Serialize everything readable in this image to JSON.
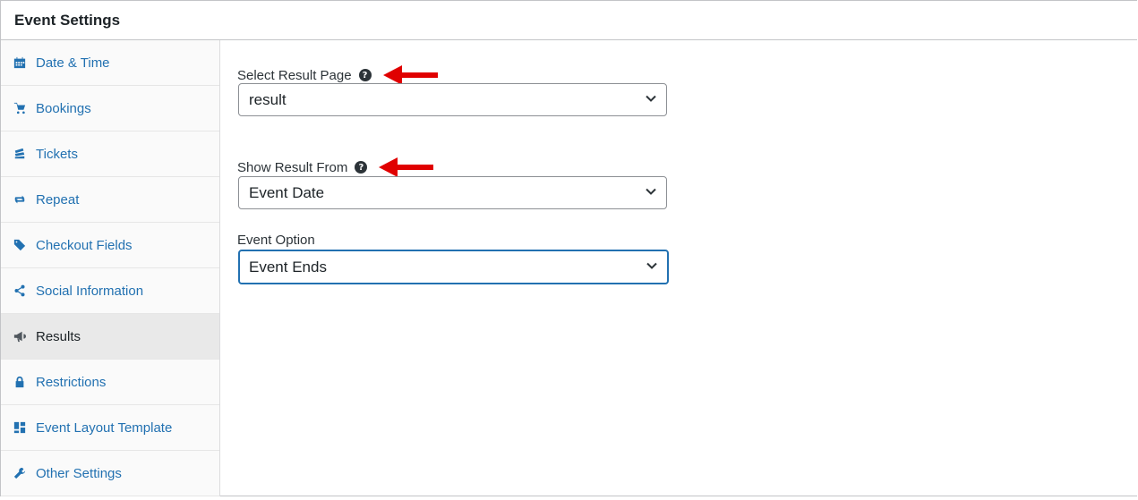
{
  "panel": {
    "title": "Event Settings"
  },
  "sidebar": {
    "items": [
      {
        "label": "Date & Time",
        "icon": "calendar-icon"
      },
      {
        "label": "Bookings",
        "icon": "cart-icon"
      },
      {
        "label": "Tickets",
        "icon": "tickets-icon"
      },
      {
        "label": "Repeat",
        "icon": "repeat-icon"
      },
      {
        "label": "Checkout Fields",
        "icon": "tag-icon"
      },
      {
        "label": "Social Information",
        "icon": "share-icon"
      },
      {
        "label": "Results",
        "icon": "megaphone-icon",
        "active": true
      },
      {
        "label": "Restrictions",
        "icon": "lock-icon"
      },
      {
        "label": "Event Layout Template",
        "icon": "layout-icon"
      },
      {
        "label": "Other Settings",
        "icon": "wrench-icon"
      }
    ]
  },
  "form": {
    "result_page": {
      "label": "Select Result Page",
      "value": "result"
    },
    "show_result_from": {
      "label": "Show Result From",
      "value": "Event Date"
    },
    "event_option": {
      "label": "Event Option",
      "value": "Event Ends"
    }
  },
  "colors": {
    "accent": "#2271b1",
    "annotation_arrow": "#e00000",
    "active_bg": "#e9e9e9"
  }
}
